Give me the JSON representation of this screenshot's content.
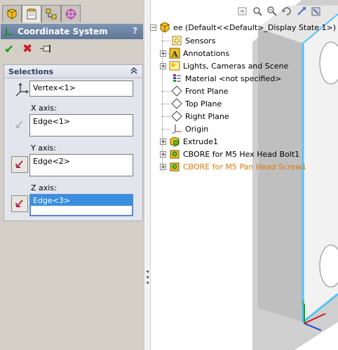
{
  "panel_tabs": [
    {
      "name": "feature-manager-tab",
      "icon": "feature-manager-icon"
    },
    {
      "name": "property-manager-tab",
      "icon": "property-manager-icon"
    },
    {
      "name": "configuration-manager-tab",
      "icon": "configuration-manager-icon"
    },
    {
      "name": "dimxpert-tab",
      "icon": "target-icon"
    }
  ],
  "property_manager": {
    "title": "Coordinate System",
    "help": "?",
    "ok_icon": "✔",
    "cancel_icon": "✖"
  },
  "selections": {
    "title": "Selections",
    "collapse_icon": "chevron-double-up-icon",
    "origin_value": "Vertex<1>",
    "x_axis_label": "X axis:",
    "x_axis_value": "Edge<1>",
    "y_axis_label": "Y axis:",
    "y_axis_value": "Edge<2>",
    "z_axis_label": "Z axis:",
    "z_axis_value": "Edge<3>"
  },
  "tree": {
    "root": "ee  (Default<<Default>_Display State 1>)",
    "items": [
      {
        "label": "Sensors",
        "icon": "sensors-icon"
      },
      {
        "label": "Annotations",
        "icon": "annotations-icon"
      },
      {
        "label": "Lights, Cameras and Scene",
        "icon": "lights-icon"
      },
      {
        "label": "Material <not specified>",
        "icon": "material-icon"
      },
      {
        "label": "Front Plane",
        "icon": "plane-icon"
      },
      {
        "label": "Top Plane",
        "icon": "plane-icon"
      },
      {
        "label": "Right Plane",
        "icon": "plane-icon"
      },
      {
        "label": "Origin",
        "icon": "origin-icon"
      },
      {
        "label": "Extrude1",
        "icon": "extrude-icon"
      },
      {
        "label": "CBORE for M5 Hex Head Bolt1",
        "icon": "hole-wizard-icon"
      },
      {
        "label": "CBORE for M5 Pan Head Screw1",
        "icon": "hole-wizard-icon"
      }
    ]
  },
  "colors": {
    "panel_bg": "#d4d0c8",
    "header_bg": "#6b82a3",
    "selection_blue": "#3a8ee0",
    "highlight_orange": "#e07800",
    "model_edge_glow": "#4fc3f7"
  },
  "viewport_toolbar": [
    "zoom-fit-icon",
    "zoom-area-icon",
    "zoom-in-out-icon",
    "rotate-icon",
    "pan-icon",
    "view-orientation-icon"
  ]
}
